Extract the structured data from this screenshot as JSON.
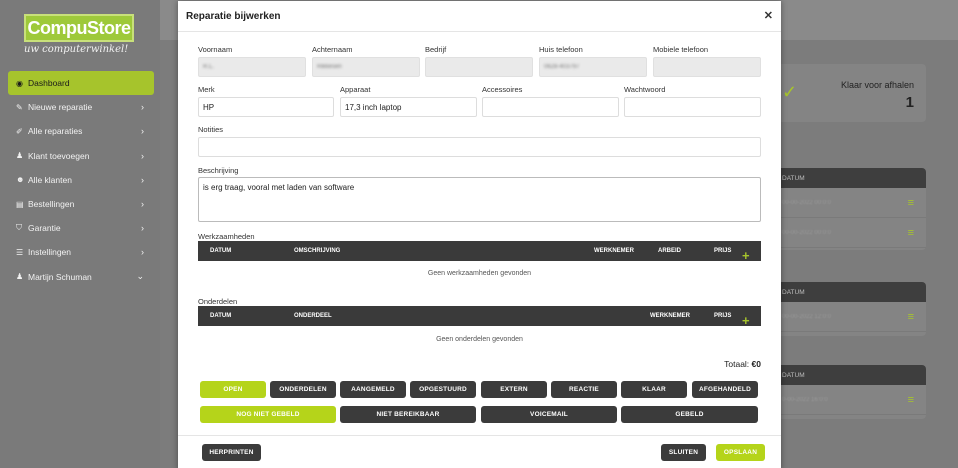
{
  "brand": {
    "name": "CompuStore",
    "name_part1": "Compu",
    "name_part2": "Store",
    "tagline": "uw computerwinkel!"
  },
  "colors": {
    "accent": "#b5d41a",
    "dark": "#3b3b3b",
    "sidebar": "#7a7a7a"
  },
  "sidebar": {
    "items": [
      {
        "label": "Dashboard",
        "icon": "dashboard-icon"
      },
      {
        "label": "Nieuwe reparatie",
        "icon": "wrench-icon"
      },
      {
        "label": "Alle reparaties",
        "icon": "tools-icon"
      },
      {
        "label": "Klant toevoegen",
        "icon": "person-icon"
      },
      {
        "label": "Alle klanten",
        "icon": "users-icon"
      },
      {
        "label": "Bestellingen",
        "icon": "cart-icon"
      },
      {
        "label": "Garantie",
        "icon": "shield-icon"
      },
      {
        "label": "Instellingen",
        "icon": "gear-icon"
      },
      {
        "label": "Martijn Schuman",
        "icon": "person-icon"
      }
    ]
  },
  "background": {
    "klaar_label": "Klaar voor afhalen",
    "klaar_count": "1",
    "datum_header": "DATUM"
  },
  "modal": {
    "title": "Reparatie bijwerken",
    "fields": {
      "voornaam": {
        "label": "Voornaam",
        "value": "R.L."
      },
      "achternaam": {
        "label": "Achternaam",
        "value": "Rikkesen"
      },
      "bedrijf": {
        "label": "Bedrijf",
        "value": ""
      },
      "huis_telefoon": {
        "label": "Huis telefoon",
        "value": "0628-403797"
      },
      "mobiele_telefoon": {
        "label": "Mobiele telefoon",
        "value": ""
      },
      "merk": {
        "label": "Merk",
        "value": "HP"
      },
      "apparaat": {
        "label": "Apparaat",
        "value": "17,3 inch laptop"
      },
      "accessoires": {
        "label": "Accessoires",
        "value": ""
      },
      "wachtwoord": {
        "label": "Wachtwoord",
        "value": ""
      },
      "notities": {
        "label": "Notities",
        "value": ""
      },
      "beschrijving": {
        "label": "Beschrijving",
        "value": "is erg traag, vooral met laden van software"
      }
    },
    "werkzaamheden": {
      "title": "Werkzaamheden",
      "columns": [
        "DATUM",
        "OMSCHRIJVING",
        "WERKNEMER",
        "ARBEID",
        "PRIJS"
      ],
      "empty": "Geen werkzaamheden gevonden"
    },
    "onderdelen": {
      "title": "Onderdelen",
      "columns": [
        "DATUM",
        "ONDERDEEL",
        "WERKNEMER",
        "PRIJS"
      ],
      "empty": "Geen onderdelen gevonden"
    },
    "totaal_label": "Totaal: ",
    "totaal_value": "€0",
    "status_buttons": [
      "OPEN",
      "ONDERDELEN",
      "AANGEMELD",
      "OPGESTUURD",
      "EXTERN",
      "REACTIE",
      "KLAAR",
      "AFGEHANDELD"
    ],
    "contact_buttons": [
      "NOG NIET GEBELD",
      "NIET BEREIKBAAR",
      "VOICEMAIL",
      "GEBELD"
    ],
    "footer": {
      "reprint": "HERPRINTEN",
      "close": "SLUITEN",
      "save": "OPSLAAN"
    }
  }
}
